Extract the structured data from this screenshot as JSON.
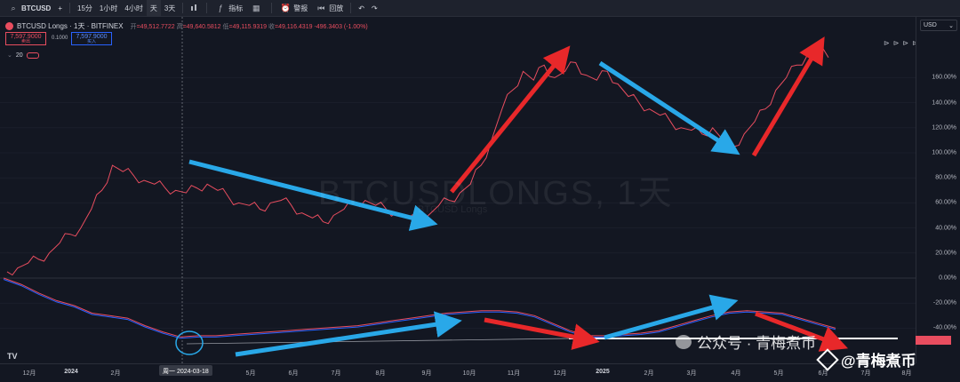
{
  "toolbar": {
    "symbol": "BTCUSD",
    "add_symbol": "+",
    "intervals": [
      "15分",
      "1小时",
      "4小时",
      "天",
      "3天"
    ],
    "active_interval": "天",
    "indicators_label": "指标",
    "alert_label": "警报",
    "replay_label": "回放",
    "undo": "↶",
    "redo": "↷"
  },
  "legend": {
    "title": "BTCUSD Longs · 1天 · BITFINEX",
    "open_key": "开",
    "open": "=49,512.7722",
    "high_key": "高",
    "high": "=49,640.5812",
    "low_key": "低",
    "low": "=49,115.9319",
    "close_key": "收",
    "close": "=49,116.4319",
    "change": "-496.3403 (-1.00%)",
    "sell_price": "7,597.9000",
    "sell_label": "卖出",
    "spread": "0.1000",
    "buy_price": "7,597.9000",
    "buy_label": "买入",
    "sub_indicator": "20"
  },
  "watermark": {
    "main": "BTCUSDLONGS, 1天",
    "sub": "BTCUSD Longs"
  },
  "price_scale": {
    "currency": "USD",
    "labels": [
      "160.00%",
      "140.00%",
      "120.00%",
      "100.00%",
      "80.00%",
      "60.00%",
      "40.00%",
      "20.00%",
      "0.00%",
      "-20.00%",
      "-40.00%"
    ]
  },
  "time_axis": {
    "labels": [
      "12月",
      "2024",
      "2月",
      "5月",
      "6月",
      "7月",
      "8月",
      "9月",
      "10月",
      "11月",
      "12月",
      "2025",
      "2月",
      "3月",
      "4月",
      "5月",
      "6月",
      "7月",
      "8月"
    ],
    "crosshair_date": "周一 2024-03-18"
  },
  "overlay": {
    "wechat_text": "公众号 · 青梅煮币",
    "brand_text": "@青梅煮币"
  },
  "colors": {
    "bg": "#131722",
    "price_line": "#e84d5f",
    "ma_line": "#2962ff",
    "arrow_red": "#e8282a",
    "arrow_blue": "#29a8e8"
  },
  "chart_data": {
    "type": "line",
    "series": [
      {
        "values_pct": [
          5,
          8,
          12,
          15,
          20,
          28,
          35,
          40,
          55,
          70,
          90,
          85,
          82,
          78,
          75,
          72,
          70,
          68,
          72,
          75,
          70,
          65,
          60,
          58,
          55,
          60,
          62,
          58,
          52,
          48,
          45,
          50,
          55,
          60,
          62,
          58,
          55,
          52,
          48,
          45,
          50,
          58,
          62,
          68,
          75,
          90,
          110,
          135,
          150,
          165,
          158,
          170,
          160,
          165,
          172,
          162,
          158,
          165,
          155,
          145,
          140,
          135,
          130,
          125,
          120,
          118,
          115,
          120,
          110,
          105,
          115,
          125,
          135,
          150,
          160,
          170,
          178,
          182,
          176
        ]
      }
    ],
    "ylim": [
      -50,
      190
    ],
    "bottom_series": [
      {
        "values_pct": [
          0,
          -5,
          -12,
          -18,
          -22,
          -28,
          -30,
          -32,
          -38,
          -43,
          -47,
          -46,
          -46,
          -45,
          -44,
          -43,
          -42,
          -41,
          -40,
          -39,
          -38,
          -36,
          -34,
          -32,
          -30,
          -28,
          -27,
          -26,
          -26,
          -27,
          -30,
          -36,
          -42,
          -46,
          -46,
          -45,
          -44,
          -42,
          -38,
          -34,
          -30,
          -27,
          -26,
          -27,
          -28,
          -32,
          -36,
          -40
        ]
      }
    ]
  }
}
